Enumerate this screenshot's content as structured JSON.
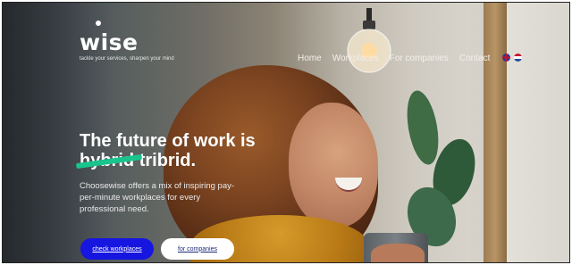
{
  "brand": {
    "logo": "wise",
    "tagline": "tackle your services, sharpen your mind"
  },
  "nav": {
    "items": [
      "Home",
      "Workplaces",
      "For companies",
      "Contact"
    ],
    "languages": [
      "english-flag-icon",
      "dutch-flag-icon"
    ]
  },
  "hero": {
    "headline_line1": "The future of work is",
    "struck_word": "hybrid",
    "headline_word": "tribrid.",
    "description": "Choosewise offers a mix of inspiring pay-per-minute workplaces for every professional need.",
    "cta_primary": "check workplaces",
    "cta_secondary": "for companies"
  },
  "colors": {
    "primary_button": "#1616e0",
    "strike_mark": "#19c58d",
    "secondary_button": "#ffffff"
  }
}
